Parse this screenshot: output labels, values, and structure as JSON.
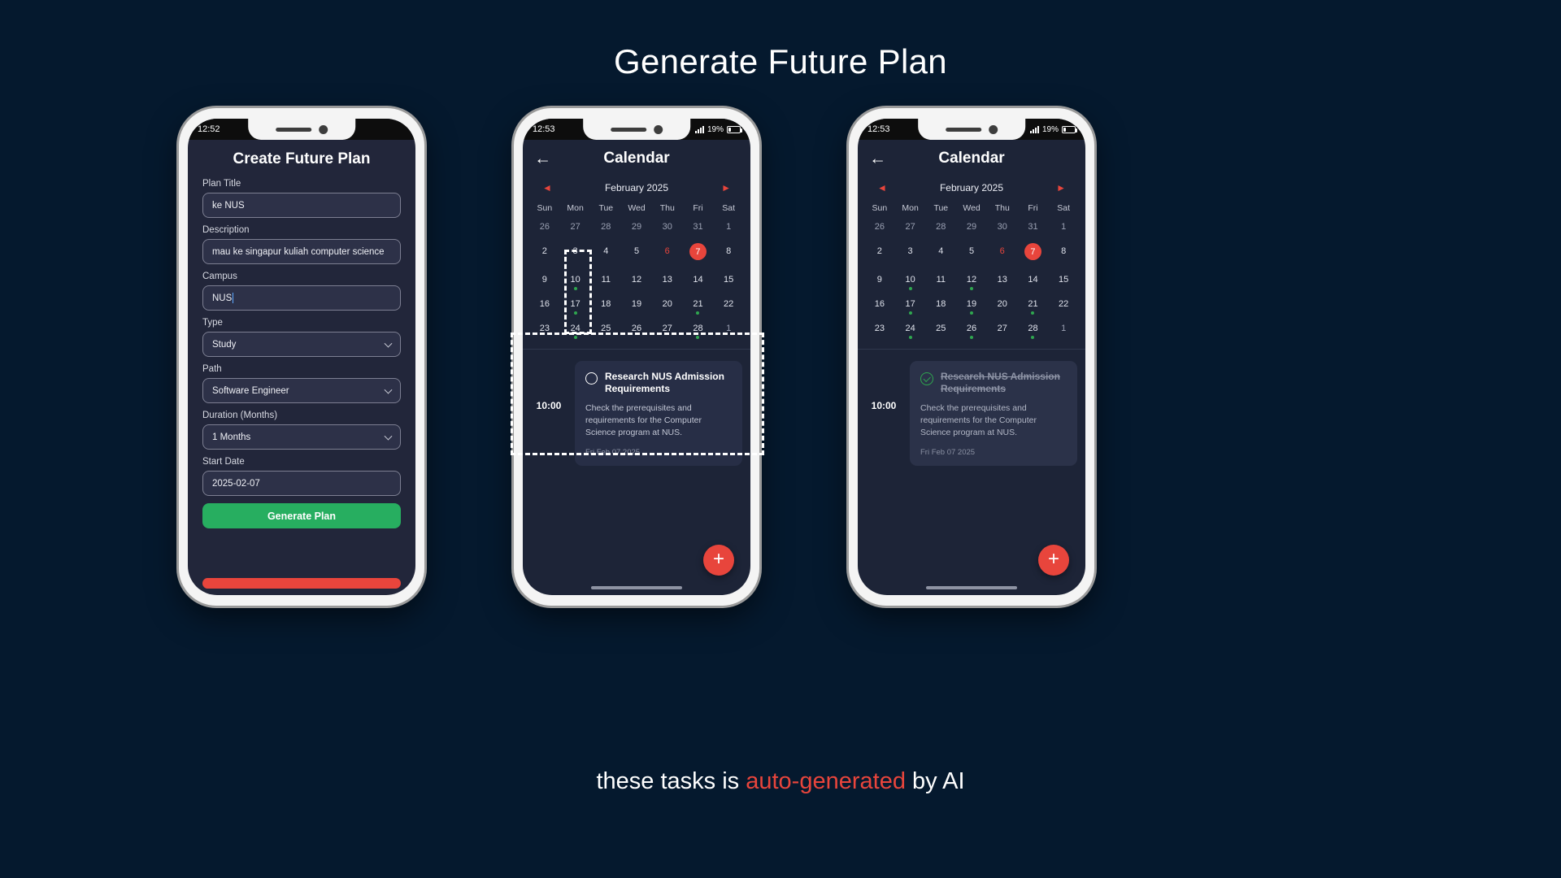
{
  "page": {
    "title": "Generate Future Plan",
    "caption_pre": "these tasks is ",
    "caption_highlight": "auto-generated",
    "caption_post": " by AI",
    "highlight_color": "#e8453c",
    "background": "#05192e"
  },
  "phone1": {
    "status": {
      "time": "12:52",
      "battery": "",
      "signal_icon": "signal-icon"
    },
    "screen_title": "Create Future Plan",
    "fields": [
      {
        "label": "Plan Title",
        "value": "ke NUS",
        "type": "text",
        "focused": false
      },
      {
        "label": "Description",
        "value": "mau ke singapur kuliah computer science",
        "type": "text",
        "focused": false
      },
      {
        "label": "Campus",
        "value": "NUS",
        "type": "text",
        "focused": true
      },
      {
        "label": "Type",
        "value": "Study",
        "type": "select",
        "focused": false
      },
      {
        "label": "Path",
        "value": "Software Engineer",
        "type": "select",
        "focused": false
      },
      {
        "label": "Duration (Months)",
        "value": "1 Months",
        "type": "select",
        "focused": false
      },
      {
        "label": "Start Date",
        "value": "2025-02-07",
        "type": "date",
        "focused": false
      }
    ],
    "submit_label": "Generate Plan",
    "submit_color": "#27ae60"
  },
  "phone2": {
    "status": {
      "time": "12:53",
      "battery": "19%",
      "signal_icon": "signal-icon"
    },
    "back_icon": "back-arrow-icon",
    "screen_title": "Calendar",
    "month": "February 2025",
    "prev_icon": "chevron-left-icon",
    "next_icon": "chevron-right-icon",
    "dow": [
      "Sun",
      "Mon",
      "Tue",
      "Wed",
      "Thu",
      "Fri",
      "Sat"
    ],
    "weeks": [
      [
        {
          "n": "26",
          "muted": true
        },
        {
          "n": "27",
          "muted": true
        },
        {
          "n": "28",
          "muted": true
        },
        {
          "n": "29",
          "muted": true
        },
        {
          "n": "30",
          "muted": true
        },
        {
          "n": "31",
          "muted": true
        },
        {
          "n": "1",
          "muted": true
        }
      ],
      [
        {
          "n": "2"
        },
        {
          "n": "3"
        },
        {
          "n": "4"
        },
        {
          "n": "5"
        },
        {
          "n": "6",
          "red": true
        },
        {
          "n": "7",
          "selected": true
        },
        {
          "n": "8"
        }
      ],
      [
        {
          "n": "9"
        },
        {
          "n": "10",
          "dot": true
        },
        {
          "n": "11"
        },
        {
          "n": "12"
        },
        {
          "n": "13"
        },
        {
          "n": "14"
        },
        {
          "n": "15"
        }
      ],
      [
        {
          "n": "16"
        },
        {
          "n": "17",
          "dot": true
        },
        {
          "n": "18"
        },
        {
          "n": "19"
        },
        {
          "n": "20"
        },
        {
          "n": "21",
          "dot": true
        },
        {
          "n": "22"
        }
      ],
      [
        {
          "n": "23"
        },
        {
          "n": "24",
          "dot": true
        },
        {
          "n": "25"
        },
        {
          "n": "26"
        },
        {
          "n": "27"
        },
        {
          "n": "28",
          "dot": true
        },
        {
          "n": "1",
          "muted": true
        }
      ]
    ],
    "event": {
      "time": "10:00",
      "title": "Research NUS Admission Requirements",
      "description": "Check the prerequisites and requirements for the Computer Science program at NUS.",
      "date": "Fri Feb 07 2025",
      "status_icon": "circle-empty-icon",
      "completed": false
    },
    "fab_label": "+",
    "fab_color": "#e8453c"
  },
  "phone3": {
    "status": {
      "time": "12:53",
      "battery": "19%",
      "signal_icon": "signal-icon"
    },
    "back_icon": "back-arrow-icon",
    "screen_title": "Calendar",
    "month": "February 2025",
    "prev_icon": "chevron-left-icon",
    "next_icon": "chevron-right-icon",
    "dow": [
      "Sun",
      "Mon",
      "Tue",
      "Wed",
      "Thu",
      "Fri",
      "Sat"
    ],
    "weeks": [
      [
        {
          "n": "26",
          "muted": true
        },
        {
          "n": "27",
          "muted": true
        },
        {
          "n": "28",
          "muted": true
        },
        {
          "n": "29",
          "muted": true
        },
        {
          "n": "30",
          "muted": true
        },
        {
          "n": "31",
          "muted": true
        },
        {
          "n": "1",
          "muted": true
        }
      ],
      [
        {
          "n": "2"
        },
        {
          "n": "3"
        },
        {
          "n": "4"
        },
        {
          "n": "5"
        },
        {
          "n": "6",
          "red": true
        },
        {
          "n": "7",
          "selected": true
        },
        {
          "n": "8"
        }
      ],
      [
        {
          "n": "9"
        },
        {
          "n": "10",
          "dot": true
        },
        {
          "n": "11"
        },
        {
          "n": "12",
          "dot": true
        },
        {
          "n": "13"
        },
        {
          "n": "14"
        },
        {
          "n": "15"
        }
      ],
      [
        {
          "n": "16"
        },
        {
          "n": "17",
          "dot": true
        },
        {
          "n": "18"
        },
        {
          "n": "19",
          "dot": true
        },
        {
          "n": "20"
        },
        {
          "n": "21",
          "dot": true
        },
        {
          "n": "22"
        }
      ],
      [
        {
          "n": "23"
        },
        {
          "n": "24",
          "dot": true
        },
        {
          "n": "25"
        },
        {
          "n": "26",
          "dot": true
        },
        {
          "n": "27"
        },
        {
          "n": "28",
          "dot": true
        },
        {
          "n": "1",
          "muted": true
        }
      ]
    ],
    "event": {
      "time": "10:00",
      "title": "Research NUS Admission Requirements",
      "description": "Check the prerequisites and requirements for the Computer Science program at NUS.",
      "date": "Fri Feb 07 2025",
      "status_icon": "circle-check-icon",
      "completed": true
    },
    "fab_label": "+",
    "fab_color": "#e8453c"
  }
}
